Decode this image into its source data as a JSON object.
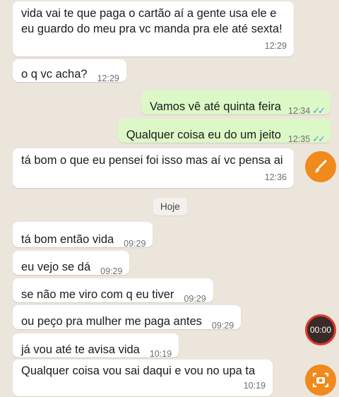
{
  "messages": [
    {
      "text": "vida vai te que paga o cartão aí a gente usa ele e eu guardo do meu pra vc manda pra ele até sexta!",
      "time": "12:29"
    },
    {
      "text": "o q vc acha?",
      "time": "12:29"
    },
    {
      "text": "Vamos vê até quinta feira",
      "time": "12:34",
      "ticks": "✓✓"
    },
    {
      "text": "Qualquer coisa eu do um jeito",
      "time": "12:35",
      "ticks": "✓✓"
    },
    {
      "text": "tá bom o que eu pensei foi isso mas aí vc pensa ai",
      "time": "12:36"
    },
    {
      "text": "tá bom então vida",
      "time": "09:29"
    },
    {
      "text": "eu vejo se dá",
      "time": "09:29"
    },
    {
      "text": "se não me viro com q eu tiver",
      "time": "09:29"
    },
    {
      "text": "ou peço pra mulher me paga antes",
      "time": "09:29"
    },
    {
      "text": "já vou até te avisa vida",
      "time": "10:19"
    },
    {
      "text": "Qualquer  coisa vou sai daqui e vou no upa ta",
      "time": "10:19"
    }
  ],
  "date_separator": "Hoje",
  "overlay": {
    "record_timer": "00:00",
    "brush_icon": "paint-brush-icon",
    "screenshot_icon": "camera-capture-icon"
  },
  "colors": {
    "incoming_bubble": "#ffffff",
    "outgoing_bubble": "#dcf8c6",
    "background": "#ece5dc",
    "read_ticks": "#4aa3d8",
    "overlay_orange": "#f08a1c",
    "record_ring": "#e23a2c"
  }
}
